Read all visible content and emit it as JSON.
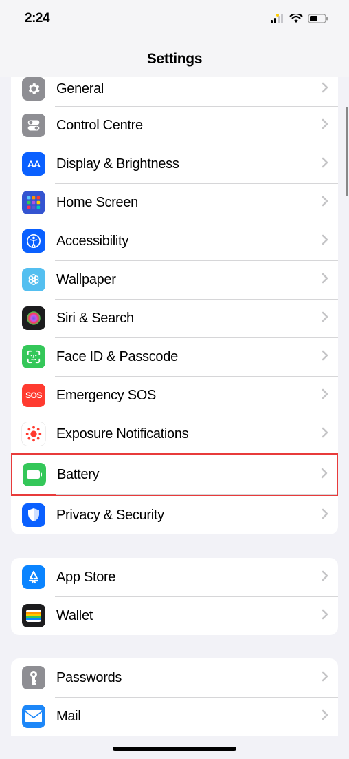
{
  "statusBar": {
    "time": "2:24"
  },
  "header": {
    "title": "Settings"
  },
  "groups": [
    {
      "first": true,
      "rows": [
        {
          "id": "general",
          "label": "General",
          "iconBg": "#8e8e93",
          "partial": true
        },
        {
          "id": "control-centre",
          "label": "Control Centre",
          "iconBg": "#8e8e93"
        },
        {
          "id": "display-brightness",
          "label": "Display & Brightness",
          "iconBg": "#0a60ff"
        },
        {
          "id": "home-screen",
          "label": "Home Screen",
          "iconBg": "#3454d1"
        },
        {
          "id": "accessibility",
          "label": "Accessibility",
          "iconBg": "#0a60ff"
        },
        {
          "id": "wallpaper",
          "label": "Wallpaper",
          "iconBg": "#54bff0"
        },
        {
          "id": "siri-search",
          "label": "Siri & Search",
          "iconBg": "#1c1c1e"
        },
        {
          "id": "face-id-passcode",
          "label": "Face ID & Passcode",
          "iconBg": "#34c759"
        },
        {
          "id": "emergency-sos",
          "label": "Emergency SOS",
          "iconBg": "#ff3b30",
          "iconText": "SOS"
        },
        {
          "id": "exposure-notifications",
          "label": "Exposure Notifications",
          "iconBg": "#ffffff"
        },
        {
          "id": "battery",
          "label": "Battery",
          "iconBg": "#34c759",
          "highlighted": true
        },
        {
          "id": "privacy-security",
          "label": "Privacy & Security",
          "iconBg": "#0a60ff"
        }
      ]
    },
    {
      "rows": [
        {
          "id": "app-store",
          "label": "App Store",
          "iconBg": "#0a84ff"
        },
        {
          "id": "wallet",
          "label": "Wallet",
          "iconBg": "#1c1c1e"
        }
      ]
    },
    {
      "last": true,
      "rows": [
        {
          "id": "passwords",
          "label": "Passwords",
          "iconBg": "#8e8e93"
        },
        {
          "id": "mail",
          "label": "Mail",
          "iconBg": "#1d87f8"
        }
      ]
    }
  ]
}
